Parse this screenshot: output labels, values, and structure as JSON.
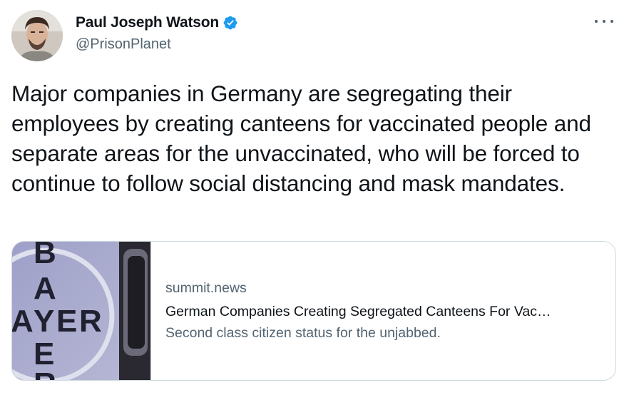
{
  "author": {
    "display_name": "Paul Joseph Watson",
    "handle": "@PrisonPlanet",
    "verified": true,
    "verified_icon": "verified-badge-icon",
    "avatar_icon": "avatar-photo"
  },
  "more_icon": "more-options-icon",
  "tweet": {
    "text": "Major companies in Germany are segregating their employees by creating canteens for vaccinated people and separate areas for the unvaccinated, who will be forced to continue to follow social distancing and mask mandates."
  },
  "link_card": {
    "domain": "summit.news",
    "title": "German Companies Creating Segregated Canteens For Vac…",
    "description": "Second class citizen status for the unjabbed.",
    "thumbnail_text": "BAYER",
    "thumbnail_icon": "bayer-logo-thumbnail"
  },
  "colors": {
    "text_primary": "#0f1419",
    "text_secondary": "#536471",
    "verified_blue": "#1d9bf0",
    "border": "#cfd9de"
  }
}
